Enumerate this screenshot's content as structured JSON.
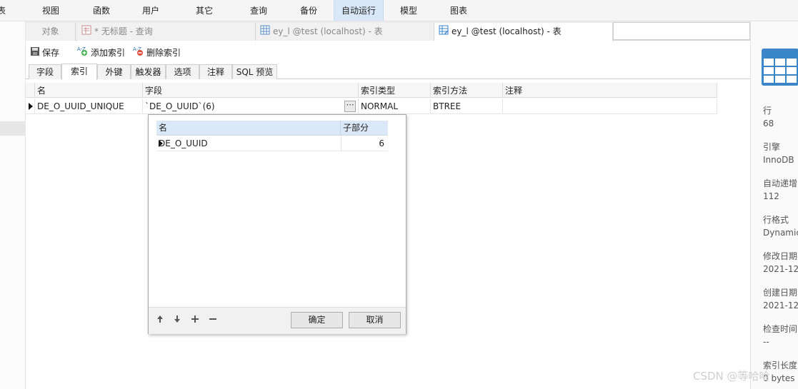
{
  "menu": {
    "items": [
      "表",
      "视图",
      "函数",
      "用户",
      "其它",
      "查询",
      "备份",
      "自动运行",
      "模型",
      "图表"
    ],
    "active": "自动运行"
  },
  "tabs": {
    "objects": "对象",
    "query": "* 无标题 - 查询",
    "table1": "ey_l @test (localhost) - 表",
    "table2": "ey_l @test (localhost) - 表"
  },
  "toolbar": {
    "save": "保存",
    "add_index": "添加索引",
    "delete_index": "删除索引"
  },
  "subtabs": [
    "字段",
    "索引",
    "外键",
    "触发器",
    "选项",
    "注释",
    "SQL 预览"
  ],
  "index_grid": {
    "columns": [
      "名",
      "字段",
      "索引类型",
      "索引方法",
      "注释"
    ],
    "rows": [
      {
        "name": "DE_O_UUID_UNIQUE",
        "fields": "`DE_O_UUID`(6)",
        "type": "NORMAL",
        "method": "BTREE",
        "comment": "",
        "ellipsis": "⋯"
      }
    ]
  },
  "popup": {
    "columns": [
      "名",
      "子部分"
    ],
    "rows": [
      {
        "name": "DE_O_UUID",
        "sub_part": "6"
      }
    ],
    "ok": "确定",
    "cancel": "取消",
    "icons": [
      "arrow-up-icon",
      "arrow-down-icon",
      "plus-icon",
      "minus-icon"
    ]
  },
  "info_panel": [
    {
      "label": "行",
      "value": "68"
    },
    {
      "label": "引擎",
      "value": "InnoDB"
    },
    {
      "label": "自动递增",
      "value": "112"
    },
    {
      "label": "行格式",
      "value": "Dynamic"
    },
    {
      "label": "修改日期",
      "value": "2021-12-"
    },
    {
      "label": "创建日期",
      "value": "2021-12-"
    },
    {
      "label": "检查时间",
      "value": "--"
    },
    {
      "label": "索引长度",
      "value": "0 bytes ("
    }
  ],
  "watermark": "CSDN @等哈哈",
  "colors": {
    "active_menu": "#d9e8f8",
    "popup_header": "#dbe8f7",
    "table_icon": "#3a86c8"
  }
}
